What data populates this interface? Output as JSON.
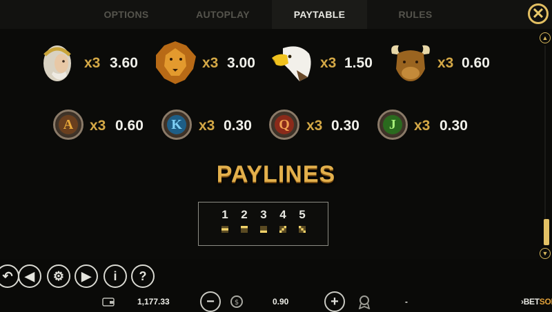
{
  "tabs": [
    {
      "label": "OPTIONS"
    },
    {
      "label": "AUTOPLAY"
    },
    {
      "label": "PAYTABLE",
      "active": true
    },
    {
      "label": "RULES"
    }
  ],
  "close_icon": "close-icon",
  "paytable": {
    "row1": [
      {
        "symbol": "emperor-head-icon",
        "multiplier": "x3",
        "payout": "3.60"
      },
      {
        "symbol": "lion-head-icon",
        "multiplier": "x3",
        "payout": "3.00"
      },
      {
        "symbol": "eagle-head-icon",
        "multiplier": "x3",
        "payout": "1.50"
      },
      {
        "symbol": "bull-head-icon",
        "multiplier": "x3",
        "payout": "0.60"
      }
    ],
    "row2": [
      {
        "letter": "A",
        "color": "#e9a93a",
        "multiplier": "x3",
        "payout": "0.60"
      },
      {
        "letter": "K",
        "color": "#3ea3dc",
        "multiplier": "x3",
        "payout": "0.30"
      },
      {
        "letter": "Q",
        "color": "#e0553a",
        "multiplier": "x3",
        "payout": "0.30"
      },
      {
        "letter": "J",
        "color": "#4dbb3a",
        "multiplier": "x3",
        "payout": "0.30"
      }
    ]
  },
  "paylines": {
    "title": "PAYLINES",
    "lines": [
      "1",
      "2",
      "3",
      "4",
      "5"
    ]
  },
  "bottom_bar": {
    "balance": "1,177.33",
    "bet": "0.90",
    "win": "-",
    "brand_prefix": "›BET",
    "brand_suffix": "SOFT"
  },
  "colors": {
    "accent_gold": "#e2bf62",
    "payout_gold": "#d4a846",
    "background": "#0b0b09"
  }
}
